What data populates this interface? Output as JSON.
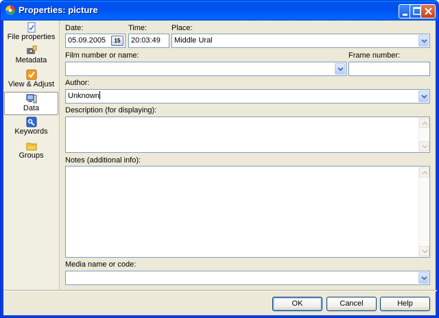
{
  "window": {
    "title": "Properties: picture"
  },
  "sidebar": {
    "items": [
      {
        "label": "File properties",
        "icon": "file-properties-icon"
      },
      {
        "label": "Metadata",
        "icon": "metadata-camera-icon"
      },
      {
        "label": "View & Adjust",
        "icon": "view-adjust-icon"
      },
      {
        "label": "Data",
        "icon": "data-icon",
        "active": true
      },
      {
        "label": "Keywords",
        "icon": "keywords-icon"
      },
      {
        "label": "Groups",
        "icon": "groups-folder-icon"
      }
    ]
  },
  "form": {
    "date": {
      "label": "Date:",
      "value": "05.09.2005",
      "calendar_label": "15"
    },
    "time": {
      "label": "Time:",
      "value": "20:03:49"
    },
    "place": {
      "label": "Place:",
      "value": "Middle Ural"
    },
    "film": {
      "label": "Film number or name:",
      "value": ""
    },
    "frame": {
      "label": "Frame number:",
      "value": ""
    },
    "author": {
      "label": "Author:",
      "value": "Unknown"
    },
    "description": {
      "label": "Description (for displaying):",
      "value": ""
    },
    "notes": {
      "label": "Notes (additional info):",
      "value": ""
    },
    "media": {
      "label": "Media name or code:",
      "value": ""
    }
  },
  "buttons": {
    "ok": "OK",
    "cancel": "Cancel",
    "help": "Help"
  },
  "colors": {
    "titlebar": "#0055e5",
    "face": "#ece9d8",
    "border": "#7f9db9"
  }
}
